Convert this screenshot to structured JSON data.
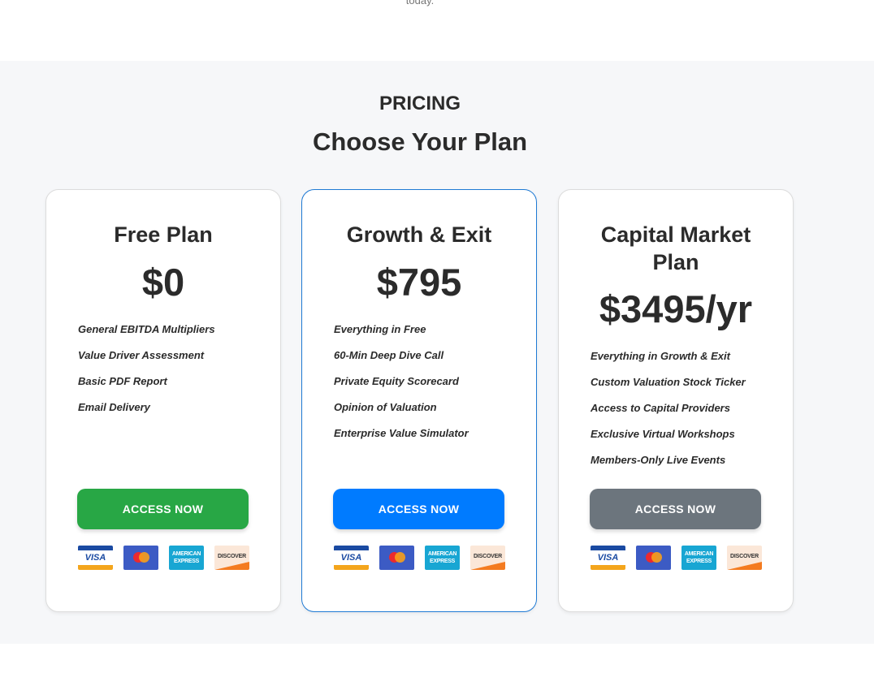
{
  "intro": {
    "tail_text": "today."
  },
  "pricing": {
    "eyebrow": "PRICING",
    "heading": "Choose Your Plan",
    "plans": [
      {
        "title": "Free Plan",
        "price": "$0",
        "features": [
          "General EBITDA Multipliers",
          "Value Driver Assessment",
          "Basic PDF Report",
          "Email Delivery"
        ],
        "button_label": "ACCESS NOW",
        "button_color": "#28a745"
      },
      {
        "title": "Growth & Exit",
        "price": "$795",
        "features": [
          "Everything in Free",
          "60-Min Deep Dive Call",
          "Private Equity Scorecard",
          "Opinion of Valuation",
          "Enterprise Value Simulator"
        ],
        "button_label": "ACCESS NOW",
        "button_color": "#007bff"
      },
      {
        "title": "Capital Market Plan",
        "price": "$3495/yr",
        "features": [
          "Everything in Growth & Exit",
          "Custom Valuation Stock Ticker",
          "Access to Capital Providers",
          "Exclusive Virtual Workshops",
          "Members-Only Live Events"
        ],
        "button_label": "ACCESS NOW",
        "button_color": "#6c757d"
      }
    ],
    "payment_icons": {
      "visa": "VISA",
      "mastercard": "mastercard-icon",
      "amex": "AMERICAN EXPRESS",
      "discover": "DISCOVER"
    }
  }
}
